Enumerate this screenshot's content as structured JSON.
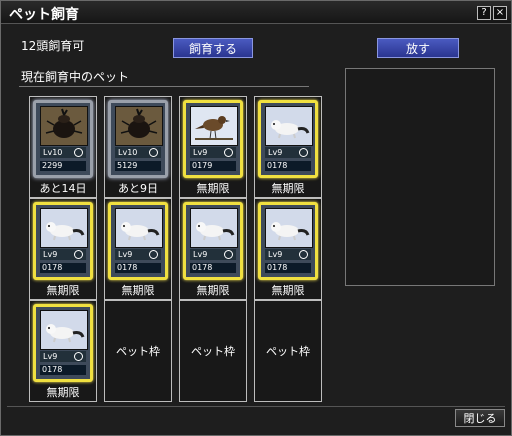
{
  "window": {
    "title": "ペット飼育"
  },
  "titlebar": {
    "help_label": "?",
    "close_label": "×"
  },
  "header": {
    "capacity": "12頭飼育可",
    "breed_label": "飼育する",
    "release_label": "放す"
  },
  "section": {
    "title": "現在飼育中のペット"
  },
  "slots": [
    {
      "type": "pet",
      "pet": "beetle",
      "level": "Lv10",
      "number": "2299",
      "caption": "あと14日",
      "frame": "steel"
    },
    {
      "type": "pet",
      "pet": "beetle",
      "level": "Lv10",
      "number": "5129",
      "caption": "あと9日",
      "frame": "steel"
    },
    {
      "type": "pet",
      "pet": "bird",
      "level": "Lv9",
      "number": "0179",
      "caption": "無期限",
      "frame": "gold"
    },
    {
      "type": "pet",
      "pet": "ferret",
      "level": "Lv9",
      "number": "0178",
      "caption": "無期限",
      "frame": "gold"
    },
    {
      "type": "pet",
      "pet": "ferret",
      "level": "Lv9",
      "number": "0178",
      "caption": "無期限",
      "frame": "gold"
    },
    {
      "type": "pet",
      "pet": "ferret",
      "level": "Lv9",
      "number": "0178",
      "caption": "無期限",
      "frame": "gold"
    },
    {
      "type": "pet",
      "pet": "ferret",
      "level": "Lv9",
      "number": "0178",
      "caption": "無期限",
      "frame": "gold"
    },
    {
      "type": "pet",
      "pet": "ferret",
      "level": "Lv9",
      "number": "0178",
      "caption": "無期限",
      "frame": "gold"
    },
    {
      "type": "pet",
      "pet": "ferret",
      "level": "Lv9",
      "number": "0178",
      "caption": "無期限",
      "frame": "gold"
    },
    {
      "type": "empty",
      "label": "ペット枠"
    },
    {
      "type": "empty",
      "label": "ペット枠"
    },
    {
      "type": "empty",
      "label": "ペット枠"
    }
  ],
  "footer": {
    "close_label": "閉じる"
  }
}
